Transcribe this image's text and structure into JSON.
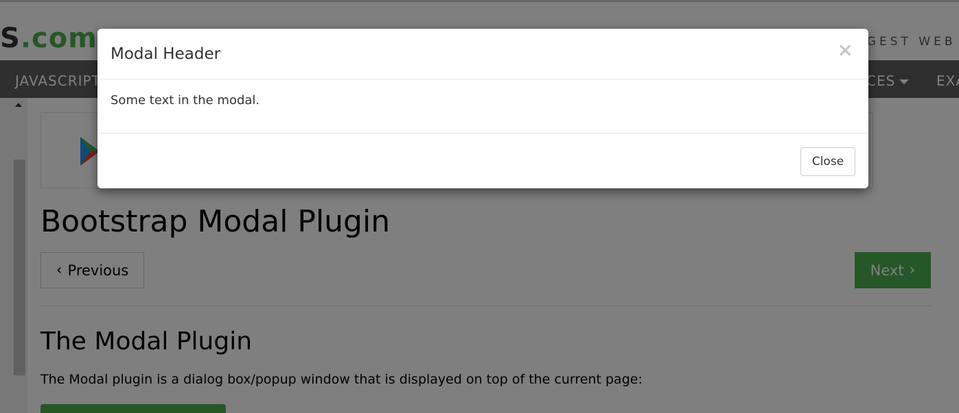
{
  "site": {
    "logo_text": "S",
    "logo_dot": ".",
    "logo_suffix": "com",
    "tagline": "RGEST WEB"
  },
  "nav": {
    "items": [
      {
        "label": "JAVASCRIPT"
      },
      {
        "label": "CES"
      },
      {
        "label": "EXA"
      }
    ]
  },
  "page": {
    "title": "Bootstrap Modal Plugin",
    "prev_label": "Previous",
    "next_label": "Next",
    "section_title": "The Modal Plugin",
    "description": "The Modal plugin is a dialog box/popup window that is displayed on top of the current page:"
  },
  "modal": {
    "title": "Modal Header",
    "close_symbol": "×",
    "body": "Some text in the modal.",
    "close_button": "Close"
  },
  "colors": {
    "accent": "#4CAF50",
    "navbar": "#5f5f5f",
    "backdrop": "rgba(0,0,0,0.5)"
  },
  "icons": [
    "caret-down-icon",
    "chevron-left-icon",
    "chevron-right-icon",
    "google-play-icon",
    "close-icon",
    "scroll-up-arrow-icon"
  ]
}
